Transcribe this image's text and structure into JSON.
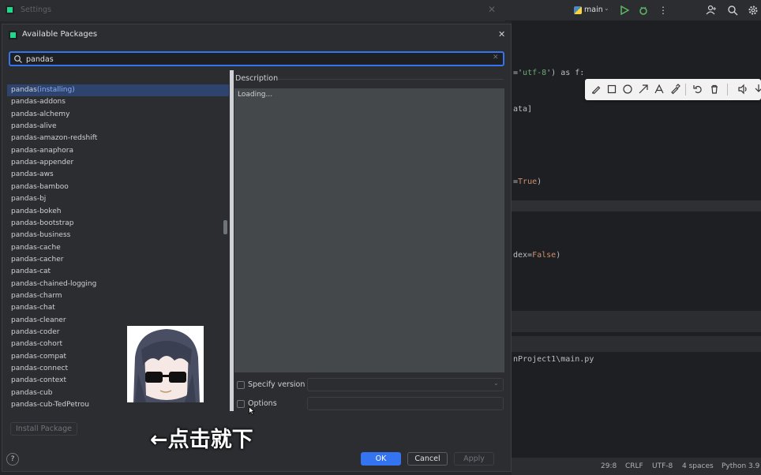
{
  "ide": {
    "branch": "main",
    "code_lines": [
      {
        "pre": "='",
        "str": "utf-8",
        "post": "') as f:"
      },
      {
        "pre": "ata]",
        "str": "",
        "post": ""
      },
      {
        "pre": "=",
        "kw": "True",
        "post": ")"
      },
      {
        "pre": "dex=",
        "kw": "False",
        "post": ")"
      }
    ],
    "run_path": "nProject1\\main.py",
    "status": {
      "position": "29:8",
      "line_sep": "CRLF",
      "encoding": "UTF-8",
      "indent": "4 spaces",
      "interpreter": "Python 3.9"
    }
  },
  "settings_window": {
    "title": "Settings"
  },
  "dialog": {
    "title": "Available Packages",
    "search": {
      "value": "pandas",
      "placeholder": ""
    },
    "packages": [
      {
        "name": "pandas",
        "note": "(installing)",
        "selected": true
      },
      {
        "name": "pandas-addons"
      },
      {
        "name": "pandas-alchemy"
      },
      {
        "name": "pandas-alive"
      },
      {
        "name": "pandas-amazon-redshift"
      },
      {
        "name": "pandas-anaphora"
      },
      {
        "name": "pandas-appender"
      },
      {
        "name": "pandas-aws"
      },
      {
        "name": "pandas-bamboo"
      },
      {
        "name": "pandas-bj"
      },
      {
        "name": "pandas-bokeh"
      },
      {
        "name": "pandas-bootstrap"
      },
      {
        "name": "pandas-business"
      },
      {
        "name": "pandas-cache"
      },
      {
        "name": "pandas-cacher"
      },
      {
        "name": "pandas-cat"
      },
      {
        "name": "pandas-chained-logging"
      },
      {
        "name": "pandas-charm"
      },
      {
        "name": "pandas-chat"
      },
      {
        "name": "pandas-cleaner"
      },
      {
        "name": "pandas-coder"
      },
      {
        "name": "pandas-cohort"
      },
      {
        "name": "pandas-compat"
      },
      {
        "name": "pandas-connect"
      },
      {
        "name": "pandas-context"
      },
      {
        "name": "pandas-cub"
      },
      {
        "name": "pandas-cub-TedPetrou"
      }
    ],
    "description_label": "Description",
    "description_text": "Loading...",
    "specify_version_label": "Specify version",
    "options_label": "Options",
    "install_button": "Install Package",
    "ok_button": "OK",
    "cancel_button": "Cancel",
    "apply_button": "Apply",
    "help_button": "?"
  },
  "overlay": {
    "subtitle": "←点击就下"
  },
  "colors": {
    "accent": "#3574f0",
    "selection": "#2e436e",
    "installing": "#8ab0f2"
  }
}
